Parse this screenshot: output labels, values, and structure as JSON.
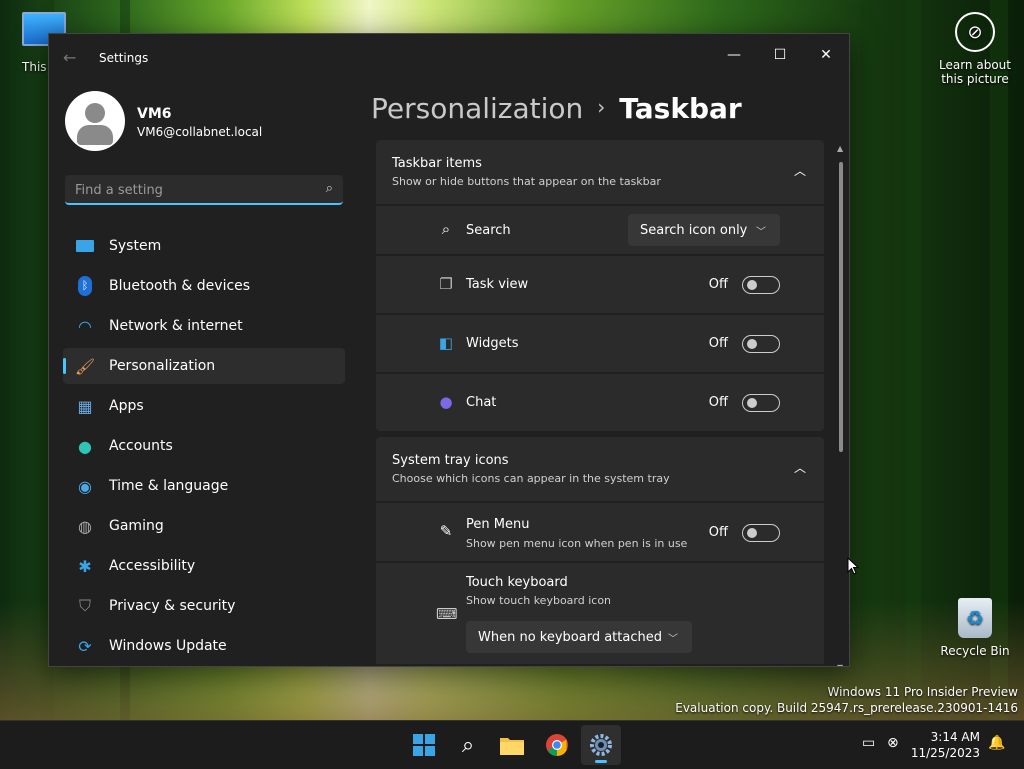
{
  "desktop": {
    "this_pc_label": "This PC",
    "learn_label_line1": "Learn about",
    "learn_label_line2": "this picture",
    "recycle_bin_label": "Recycle Bin",
    "watermark_line1": "Windows 11 Pro Insider Preview",
    "watermark_line2": "Evaluation copy. Build 25947.rs_prerelease.230901-1416"
  },
  "window": {
    "title": "Settings",
    "controls": {
      "minimize": "—",
      "maximize": "☐",
      "close": "✕"
    }
  },
  "profile": {
    "name": "VM6",
    "email": "VM6@collabnet.local"
  },
  "search": {
    "placeholder": "Find a setting",
    "value": ""
  },
  "nav": {
    "items": [
      {
        "label": "System",
        "icon": "monitor-icon"
      },
      {
        "label": "Bluetooth & devices",
        "icon": "bluetooth-icon"
      },
      {
        "label": "Network & internet",
        "icon": "wifi-icon"
      },
      {
        "label": "Personalization",
        "icon": "brush-icon",
        "selected": true
      },
      {
        "label": "Apps",
        "icon": "apps-icon"
      },
      {
        "label": "Accounts",
        "icon": "person-icon"
      },
      {
        "label": "Time & language",
        "icon": "globe-clock-icon"
      },
      {
        "label": "Gaming",
        "icon": "gamepad-icon"
      },
      {
        "label": "Accessibility",
        "icon": "accessibility-icon"
      },
      {
        "label": "Privacy & security",
        "icon": "shield-icon"
      },
      {
        "label": "Windows Update",
        "icon": "update-icon"
      }
    ]
  },
  "header": {
    "crumb": "Personalization",
    "separator": "›",
    "current": "Taskbar"
  },
  "taskbar_items": {
    "title": "Taskbar items",
    "subtitle": "Show or hide buttons that appear on the taskbar",
    "search": {
      "label": "Search",
      "value": "Search icon only"
    },
    "task_view": {
      "label": "Task view",
      "state": "Off"
    },
    "widgets": {
      "label": "Widgets",
      "state": "Off"
    },
    "chat": {
      "label": "Chat",
      "state": "Off"
    }
  },
  "system_tray": {
    "title": "System tray icons",
    "subtitle": "Choose which icons can appear in the system tray",
    "pen_menu": {
      "label": "Pen Menu",
      "sub": "Show pen menu icon when pen is in use",
      "state": "Off"
    },
    "touch_keyboard": {
      "label": "Touch keyboard",
      "sub": "Show touch keyboard icon",
      "value": "When no keyboard attached"
    }
  },
  "taskbar": {
    "time": "3:14 AM",
    "date": "11/25/2023"
  },
  "colors": {
    "accent": "#4cc2ff",
    "window_bg": "#202020",
    "card_bg": "#2b2b2b"
  }
}
